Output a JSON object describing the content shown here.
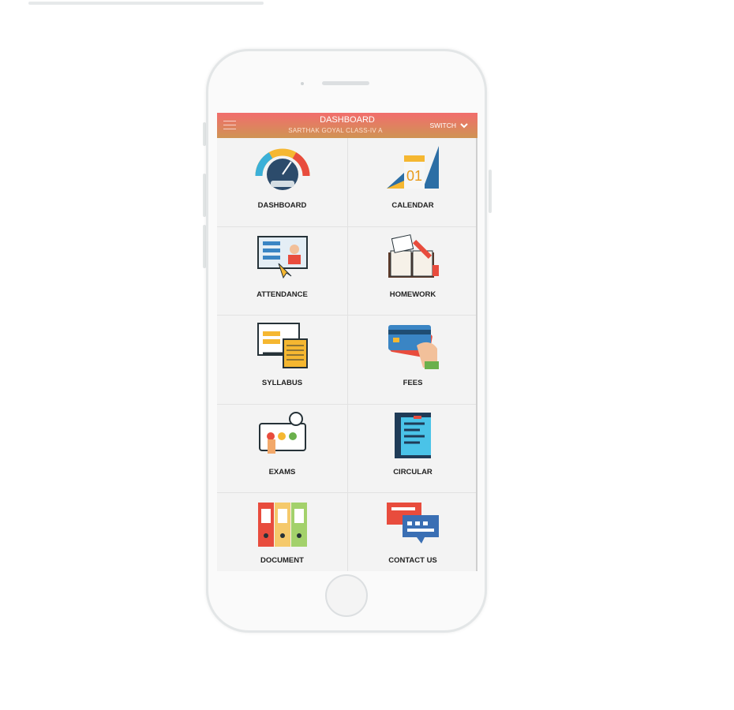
{
  "header": {
    "title": "DASHBOARD",
    "subtitle": "SARTHAK GOYAL CLASS-IV A",
    "switch_label": "SWITCH"
  },
  "tiles": [
    {
      "label": "DASHBOARD",
      "icon": "speedometer-icon"
    },
    {
      "label": "CALENDAR",
      "icon": "calendar-icon",
      "icon_text": "01"
    },
    {
      "label": "ATTENDANCE",
      "icon": "attendance-board-icon"
    },
    {
      "label": "HOMEWORK",
      "icon": "open-book-icon"
    },
    {
      "label": "SYLLABUS",
      "icon": "syllabus-document-icon"
    },
    {
      "label": "FEES",
      "icon": "credit-card-icon"
    },
    {
      "label": "EXAMS",
      "icon": "exam-timer-icon"
    },
    {
      "label": "CIRCULAR",
      "icon": "circular-notice-icon"
    },
    {
      "label": "DOCUMENT",
      "icon": "binders-icon"
    },
    {
      "label": "CONTACT US",
      "icon": "chat-bubbles-icon"
    }
  ],
  "colors": {
    "header_top": "#f26d6d",
    "header_bottom": "#cf9454"
  }
}
